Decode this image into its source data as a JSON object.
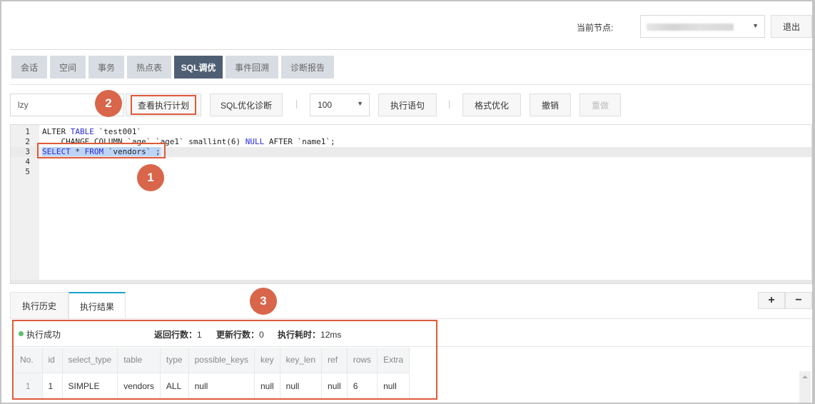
{
  "header": {
    "node_label": "当前节点:",
    "node_value_redacted": true,
    "logout_label": "退出"
  },
  "tabs": [
    {
      "label": "会话",
      "active": false
    },
    {
      "label": "空间",
      "active": false
    },
    {
      "label": "事务",
      "active": false
    },
    {
      "label": "热点表",
      "active": false
    },
    {
      "label": "SQL调优",
      "active": true
    },
    {
      "label": "事件回溯",
      "active": false
    },
    {
      "label": "诊断报告",
      "active": false
    }
  ],
  "toolbar": {
    "database_value": "lzy",
    "explain_label": "查看执行计划",
    "diagnose_label": "SQL优化诊断",
    "limit_value": "100",
    "execute_label": "执行语句",
    "format_label": "格式优化",
    "undo_label": "撤销",
    "redo_label": "重做"
  },
  "editor": {
    "lines": [
      {
        "num": "1",
        "text": "ALTER TABLE `test001`"
      },
      {
        "num": "2",
        "text": "    CHANGE COLUMN `age` `age1` smallint(6) NULL AFTER `name1`;"
      },
      {
        "num": "3",
        "text": "SELECT * FROM `vendors` ;"
      },
      {
        "num": "4",
        "text": ""
      },
      {
        "num": "5",
        "text": ""
      }
    ],
    "active_line": 3
  },
  "annotations": {
    "step1": "1",
    "step2": "2",
    "step3": "3",
    "color": "#e05a3a"
  },
  "results": {
    "tabs": [
      {
        "label": "执行历史",
        "active": false
      },
      {
        "label": "执行结果",
        "active": true
      }
    ],
    "add_label": "+",
    "remove_label": "−",
    "status": "执行成功",
    "status_color": "#5cc16d",
    "rows_returned_label": "返回行数：",
    "rows_returned": "1",
    "rows_updated_label": "更新行数：",
    "rows_updated": "0",
    "exec_time_label": "执行耗时：",
    "exec_time": "12ms",
    "columns": [
      "No.",
      "id",
      "select_type",
      "table",
      "type",
      "possible_keys",
      "key",
      "key_len",
      "ref",
      "rows",
      "Extra"
    ],
    "rows": [
      [
        "1",
        "1",
        "SIMPLE",
        "vendors",
        "ALL",
        "null",
        "null",
        "null",
        "null",
        "6",
        "null"
      ]
    ]
  }
}
